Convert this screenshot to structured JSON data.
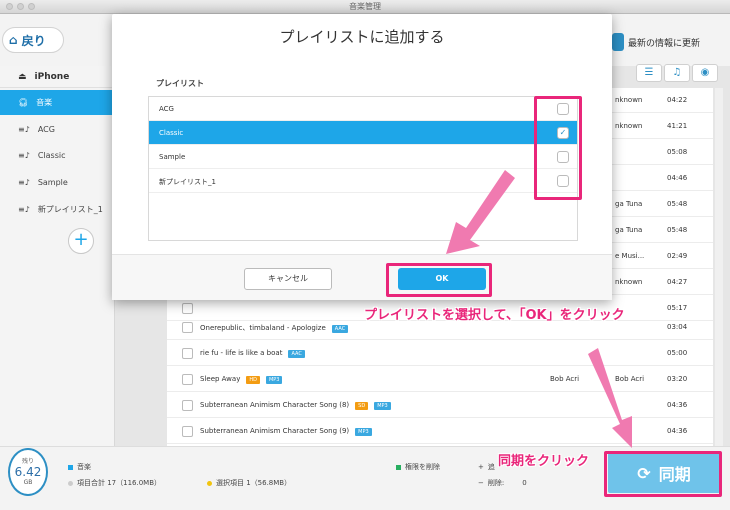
{
  "window": {
    "title": "音楽管理"
  },
  "header": {
    "back_label": "戻り",
    "update_label": "最新の情報に更新"
  },
  "sidebar": {
    "device": "iPhone",
    "items": [
      {
        "label": "音楽"
      },
      {
        "label": "ACG"
      },
      {
        "label": "Classic"
      },
      {
        "label": "Sample"
      },
      {
        "label": "新プレイリスト_1"
      }
    ],
    "add_label": "+"
  },
  "list": {
    "rows": [
      {
        "title": "",
        "tag": "",
        "artist": "",
        "album": "nknown",
        "duration": "04:22"
      },
      {
        "title": "",
        "tag": "",
        "artist": "",
        "album": "nknown",
        "duration": "41:21"
      },
      {
        "title": "",
        "tag": "",
        "artist": "",
        "album": "",
        "duration": "05:08"
      },
      {
        "title": "",
        "tag": "",
        "artist": "",
        "album": "",
        "duration": "04:46"
      },
      {
        "title": "",
        "tag": "",
        "artist": "",
        "album": "ga Tuna",
        "duration": "05:48"
      },
      {
        "title": "",
        "tag": "",
        "artist": "",
        "album": "ga Tuna",
        "duration": "05:48"
      },
      {
        "title": "",
        "tag": "",
        "artist": "",
        "album": "e Musi...",
        "duration": "02:49"
      },
      {
        "title": "",
        "tag": "",
        "artist": "",
        "album": "nknown",
        "duration": "04:27"
      },
      {
        "title": "",
        "tag": "",
        "artist": "",
        "album": "",
        "duration": "05:17"
      },
      {
        "title": "Onerepublic、timbaland - Apologize",
        "tag": "AAC",
        "artist": "",
        "album": "",
        "duration": "03:04"
      },
      {
        "title": "rie fu - life is like a boat",
        "tag": "AAC",
        "artist": "",
        "album": "",
        "duration": "05:00"
      },
      {
        "title": "Sleep Away",
        "tag": "MP3",
        "tag2": "HD",
        "artist": "Bob Acri",
        "album": "Bob Acri",
        "duration": "03:20"
      },
      {
        "title": "Subterranean Animism Character Song (8)",
        "tag": "MP3",
        "tag2": "SD",
        "artist": "",
        "album": "",
        "duration": "04:36"
      },
      {
        "title": "Subterranean Animism Character Song (9)",
        "tag": "MP3",
        "artist": "",
        "album": "",
        "duration": "04:36"
      }
    ]
  },
  "footer": {
    "remaining_label": "残り",
    "remaining_value": "6.42",
    "remaining_unit": "GB",
    "music_label": "音楽",
    "total_label": "項目合計 17（116.0MB）",
    "selected_label": "選択項目 1（56.8MB）",
    "remove_rights_label": "権限を削除",
    "add_short": "追",
    "delete_label": "削除:",
    "delete_value": "0",
    "sync_label": "同期"
  },
  "modal": {
    "title": "プレイリストに追加する",
    "section_label": "プレイリスト",
    "playlists": [
      {
        "name": "ACG",
        "checked": false
      },
      {
        "name": "Classic",
        "checked": true
      },
      {
        "name": "Sample",
        "checked": false
      },
      {
        "name": "新プレイリスト_1",
        "checked": false
      }
    ],
    "cancel_label": "キャンセル",
    "ok_label": "OK"
  },
  "annotations": {
    "note1": "プレイリストを選択して、「OK」をクリック",
    "note2": "同期をクリック",
    "accent": "#e9267a"
  }
}
